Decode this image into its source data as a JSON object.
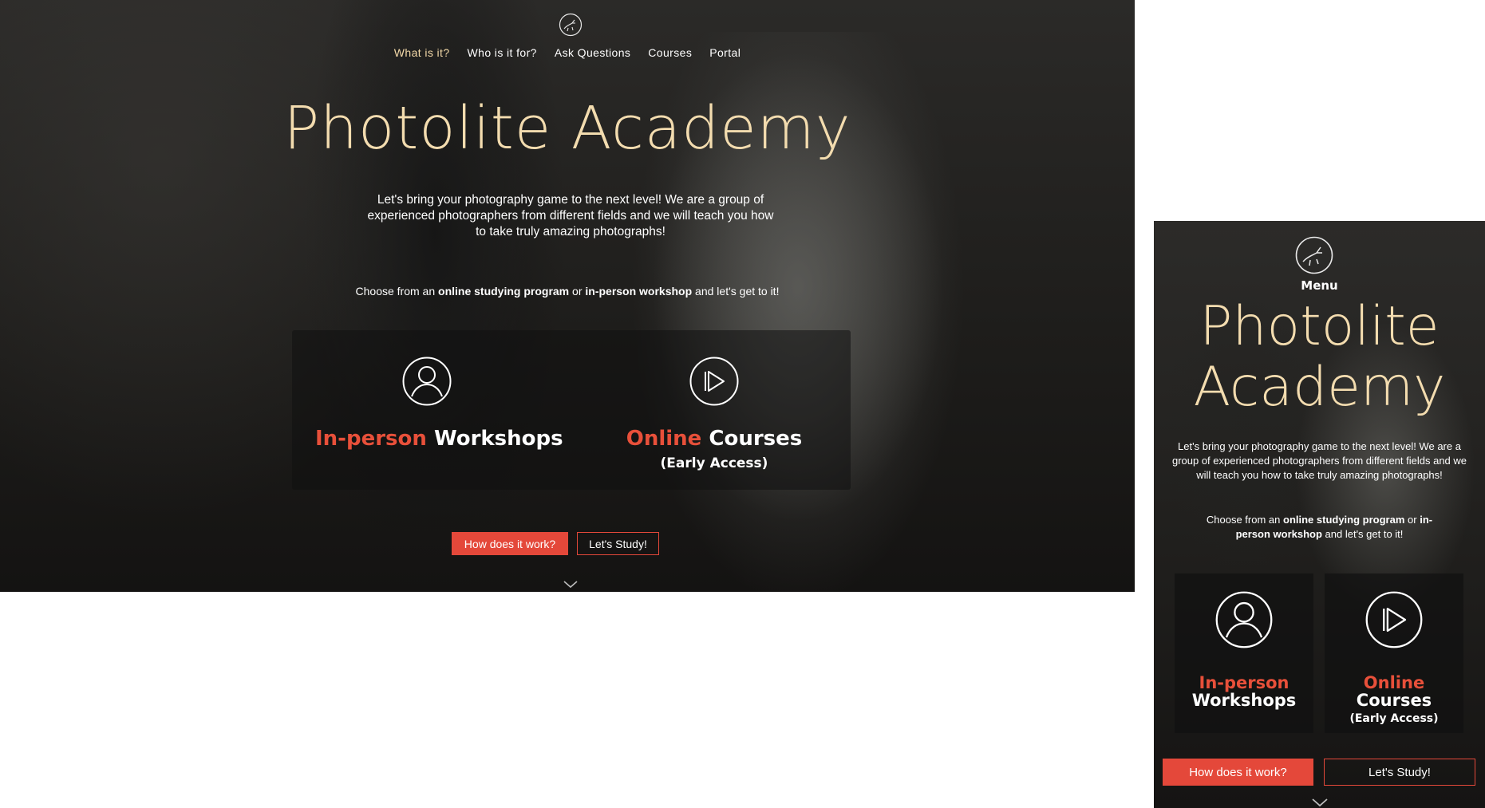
{
  "brand": {
    "name": "Photolite Academy",
    "accent_color": "#e4483a",
    "title_color": "#f3dcaf",
    "logo_icon": "deer-logo-icon"
  },
  "nav": {
    "items": [
      {
        "label": "What is it?",
        "active": true
      },
      {
        "label": "Who is it for?",
        "active": false
      },
      {
        "label": "Ask Questions",
        "active": false
      },
      {
        "label": "Courses",
        "active": false
      },
      {
        "label": "Portal",
        "active": false
      }
    ]
  },
  "mobile_menu_label": "Menu",
  "hero": {
    "title": "Photolite Academy",
    "title_line1": "Photolite",
    "title_line2": "Academy",
    "intro": "Let's bring your photography game to the next level! We are a group of experienced photographers from different fields and we will teach you how to take truly amazing photographs!",
    "choose": {
      "prefix": "Choose from an ",
      "option1": "online studying program",
      "middle": " or ",
      "option2": "in-person workshop",
      "suffix": " and let's get to it!"
    }
  },
  "cards": [
    {
      "icon": "user-icon",
      "accent": "In-person",
      "rest": "Workshops",
      "sub": ""
    },
    {
      "icon": "play-icon",
      "accent": "Online",
      "rest": "Courses",
      "sub": "(Early Access)"
    }
  ],
  "buttons": {
    "primary": "How does it work?",
    "secondary": "Let's Study!"
  },
  "scroll_icon": "chevron-down-icon"
}
